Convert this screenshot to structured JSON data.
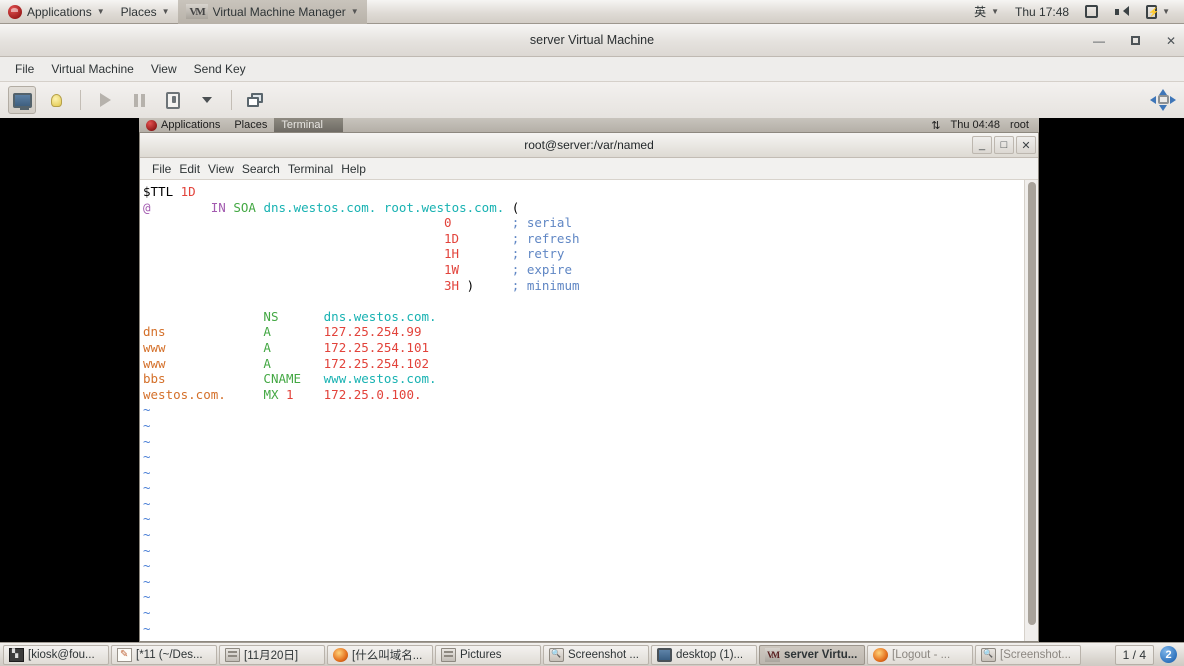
{
  "host_panel": {
    "applications": "Applications",
    "places": "Places",
    "active_app": "Virtual Machine Manager",
    "input_method": "英",
    "clock": "Thu 17:48",
    "icons": [
      "display-icon",
      "volume-icon",
      "battery-icon",
      "chevron-down-icon"
    ]
  },
  "vmm_window": {
    "title": "server Virtual Machine",
    "menu": [
      "File",
      "Virtual Machine",
      "View",
      "Send Key"
    ],
    "window_controls": {
      "minimize": "—",
      "maximize": "□",
      "close": "✕"
    },
    "toolbar": [
      "console-view-icon",
      "details-lightbulb-icon",
      "run-play-icon",
      "pause-icon",
      "shutdown-icon",
      "shutdown-dropdown-icon",
      "snapshots-icon",
      "fullscreen-resize-icon"
    ]
  },
  "guest_panel": {
    "applications": "Applications",
    "places": "Places",
    "window": "Terminal",
    "clock": "Thu 04:48",
    "user": "root"
  },
  "terminal": {
    "title": "root@server:/var/named",
    "menu": [
      "File",
      "Edit",
      "View",
      "Search",
      "Terminal",
      "Help"
    ],
    "window_controls": {
      "minimize": "_",
      "maximize": "□",
      "close": "✕"
    },
    "content": [
      [
        {
          "t": "$TTL ",
          "c": "c-black"
        },
        {
          "t": "1D",
          "c": "c-red"
        }
      ],
      [
        {
          "t": "@",
          "c": "c-purple"
        },
        {
          "t": "        ",
          "c": "c-black"
        },
        {
          "t": "IN ",
          "c": "c-purple"
        },
        {
          "t": "SOA",
          "c": "c-green"
        },
        {
          "t": " ",
          "c": "c-black"
        },
        {
          "t": "dns.westos.com. root.westos.com.",
          "c": "c-cyan"
        },
        {
          "t": " (",
          "c": "c-black"
        }
      ],
      [
        {
          "t": "                                        ",
          "c": "c-black"
        },
        {
          "t": "0",
          "c": "c-red"
        },
        {
          "t": "        ",
          "c": "c-black"
        },
        {
          "t": "; serial",
          "c": "c-comment"
        }
      ],
      [
        {
          "t": "                                        ",
          "c": "c-black"
        },
        {
          "t": "1D",
          "c": "c-red"
        },
        {
          "t": "       ",
          "c": "c-black"
        },
        {
          "t": "; refresh",
          "c": "c-comment"
        }
      ],
      [
        {
          "t": "                                        ",
          "c": "c-black"
        },
        {
          "t": "1H",
          "c": "c-red"
        },
        {
          "t": "       ",
          "c": "c-black"
        },
        {
          "t": "; retry",
          "c": "c-comment"
        }
      ],
      [
        {
          "t": "                                        ",
          "c": "c-black"
        },
        {
          "t": "1W",
          "c": "c-red"
        },
        {
          "t": "       ",
          "c": "c-black"
        },
        {
          "t": "; expire",
          "c": "c-comment"
        }
      ],
      [
        {
          "t": "                                        ",
          "c": "c-black"
        },
        {
          "t": "3H",
          "c": "c-red"
        },
        {
          "t": " )     ",
          "c": "c-black"
        },
        {
          "t": "; minimum",
          "c": "c-comment"
        }
      ],
      [
        {
          "t": "",
          "c": "c-black"
        }
      ],
      [
        {
          "t": "                ",
          "c": "c-black"
        },
        {
          "t": "NS",
          "c": "c-green"
        },
        {
          "t": "      ",
          "c": "c-black"
        },
        {
          "t": "dns.westos.com.",
          "c": "c-cyan"
        }
      ],
      [
        {
          "t": "dns",
          "c": "c-orange"
        },
        {
          "t": "             ",
          "c": "c-black"
        },
        {
          "t": "A",
          "c": "c-green"
        },
        {
          "t": "       ",
          "c": "c-black"
        },
        {
          "t": "127.25.254.99",
          "c": "c-red"
        }
      ],
      [
        {
          "t": "www",
          "c": "c-orange"
        },
        {
          "t": "             ",
          "c": "c-black"
        },
        {
          "t": "A",
          "c": "c-green"
        },
        {
          "t": "       ",
          "c": "c-black"
        },
        {
          "t": "172.25.254.101",
          "c": "c-red"
        }
      ],
      [
        {
          "t": "www",
          "c": "c-orange"
        },
        {
          "t": "             ",
          "c": "c-black"
        },
        {
          "t": "A",
          "c": "c-green"
        },
        {
          "t": "       ",
          "c": "c-black"
        },
        {
          "t": "172.25.254.102",
          "c": "c-red"
        }
      ],
      [
        {
          "t": "bbs",
          "c": "c-orange"
        },
        {
          "t": "             ",
          "c": "c-black"
        },
        {
          "t": "CNAME",
          "c": "c-green"
        },
        {
          "t": "   ",
          "c": "c-black"
        },
        {
          "t": "www.westos.com.",
          "c": "c-cyan"
        }
      ],
      [
        {
          "t": "westos.com.",
          "c": "c-orange"
        },
        {
          "t": "     ",
          "c": "c-black"
        },
        {
          "t": "MX ",
          "c": "c-green"
        },
        {
          "t": "1",
          "c": "c-red"
        },
        {
          "t": "    ",
          "c": "c-black"
        },
        {
          "t": "172.25.0.100.",
          "c": "c-red"
        }
      ]
    ],
    "tilde_marker": "~",
    "tilde_count": 16
  },
  "taskbar": {
    "tasks": [
      {
        "label": "[kiosk@fou...",
        "icon": "terminal-icon",
        "state": "normal"
      },
      {
        "label": "[*11 (~/Des...",
        "icon": "text-editor-icon",
        "state": "normal"
      },
      {
        "label": "[11月20日]",
        "icon": "document-icon",
        "state": "normal"
      },
      {
        "label": "[什么叫域名...",
        "icon": "firefox-icon",
        "state": "normal"
      },
      {
        "label": "Pictures",
        "icon": "file-manager-icon",
        "state": "normal"
      },
      {
        "label": "Screenshot ...",
        "icon": "screenshot-icon",
        "state": "normal"
      },
      {
        "label": "desktop (1)...",
        "icon": "monitor-icon",
        "state": "normal"
      },
      {
        "label": "server Virtu...",
        "icon": "vmm-icon",
        "state": "active"
      },
      {
        "label": "[Logout - ...",
        "icon": "firefox-icon",
        "state": "dim"
      },
      {
        "label": "[Screenshot...",
        "icon": "screenshot-icon",
        "state": "dim"
      }
    ],
    "workspace": "1 / 4",
    "badge": "2"
  }
}
